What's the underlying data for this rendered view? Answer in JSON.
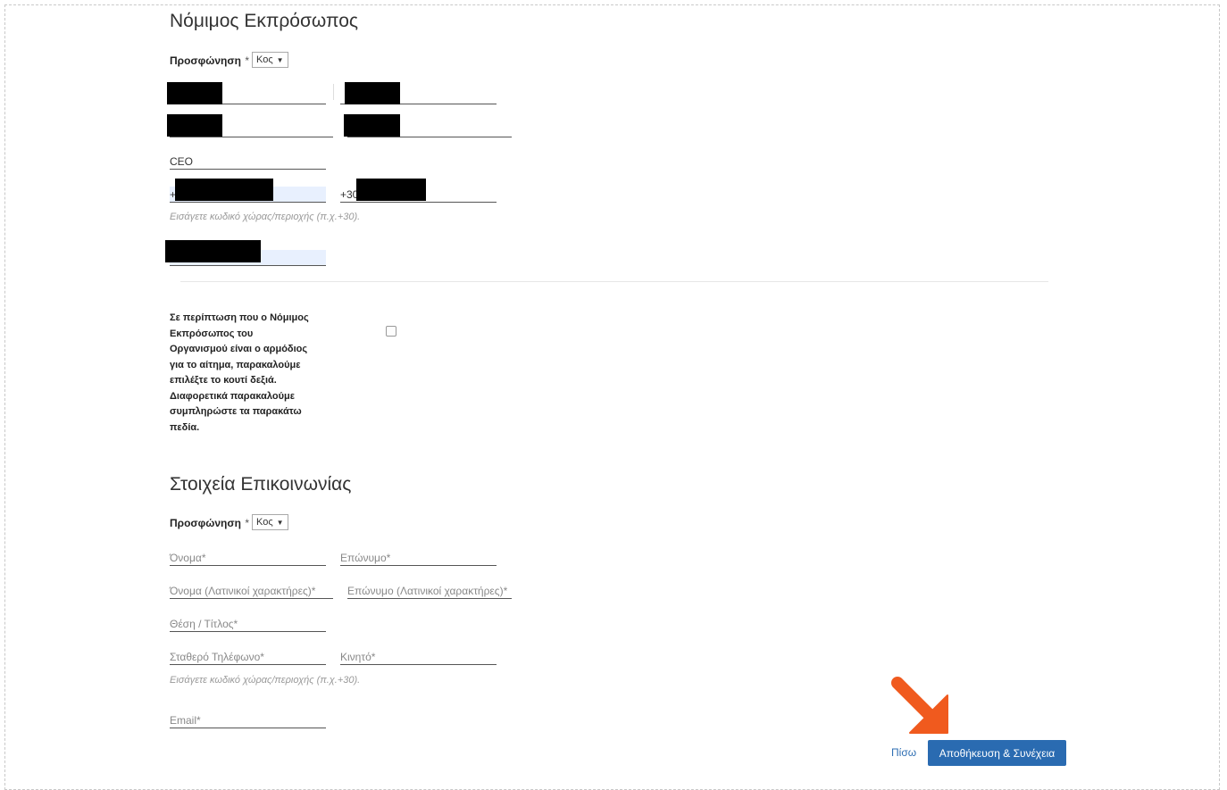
{
  "legal_rep": {
    "title": "Νόμιμος Εκπρόσωπος",
    "salutation_label": "Προσφώνηση",
    "required_mark": "*",
    "salutation_value": "Κος",
    "position_value": "CEO",
    "landline_prefix": "+",
    "mobile_prefix": "+30",
    "phone_help": "Εισάγετε κωδικό χώρας/περιοχής (π.χ.+30)."
  },
  "note": {
    "text": "Σε περίπτωση που ο Νόμιμος Εκπρόσωπος του Οργανισμού είναι ο αρμόδιος για το αίτημα, παρακαλούμε επιλέξτε το κουτί δεξιά. Διαφορετικά παρακαλούμε συμπληρώστε τα παρακάτω πεδία.",
    "checked": false
  },
  "contact": {
    "title": "Στοιχεία Επικοινωνίας",
    "salutation_label": "Προσφώνηση",
    "required_mark": "*",
    "salutation_value": "Κος",
    "first_name_placeholder": "Όνομα*",
    "last_name_placeholder": "Επώνυμο*",
    "first_name_latin_placeholder": "Όνομα (Λατινικοί χαρακτήρες)*",
    "last_name_latin_placeholder": "Επώνυμο (Λατινικοί χαρακτήρες)*",
    "position_placeholder": "Θέση / Τίτλος*",
    "landline_placeholder": "Σταθερό Τηλέφωνο*",
    "mobile_placeholder": "Κινητό*",
    "phone_help": "Εισάγετε κωδικό χώρας/περιοχής (π.χ.+30).",
    "email_placeholder": "Email*"
  },
  "actions": {
    "back_label": "Πίσω",
    "save_label": "Αποθήκευση & Συνέχεια"
  },
  "colors": {
    "primary_button": "#2a6bb1",
    "arrow_annotation": "#f05a1e",
    "autofill_bg": "#e8f0fe"
  }
}
